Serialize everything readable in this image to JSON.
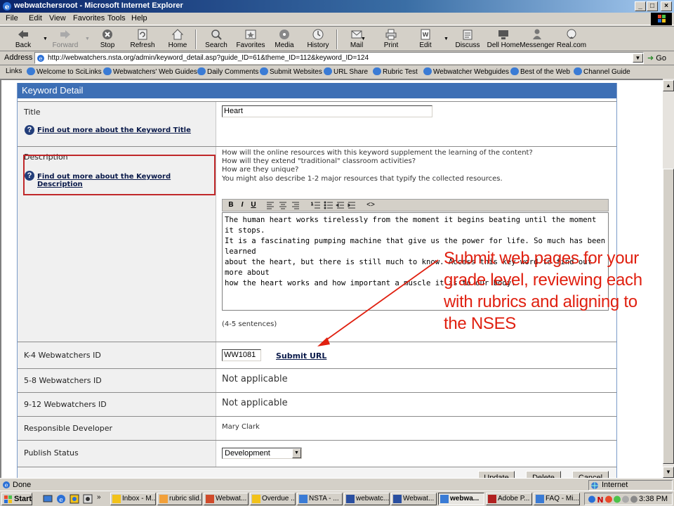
{
  "window": {
    "title": "webwatchersroot - Microsoft Internet Explorer",
    "minimize": "_",
    "maximize": "□",
    "close": "×"
  },
  "menu": [
    "File",
    "Edit",
    "View",
    "Favorites",
    "Tools",
    "Help"
  ],
  "toolbar": {
    "buttons": [
      {
        "label": "Back",
        "icon": "back-arrow-icon"
      },
      {
        "label": "Forward",
        "icon": "forward-arrow-icon",
        "disabled": true
      },
      {
        "label": "Stop",
        "icon": "stop-icon"
      },
      {
        "label": "Refresh",
        "icon": "refresh-icon"
      },
      {
        "label": "Home",
        "icon": "home-icon"
      },
      {
        "label": "Search",
        "icon": "search-icon"
      },
      {
        "label": "Favorites",
        "icon": "favorites-icon"
      },
      {
        "label": "Media",
        "icon": "media-icon"
      },
      {
        "label": "History",
        "icon": "history-icon"
      },
      {
        "label": "Mail",
        "icon": "mail-icon"
      },
      {
        "label": "Print",
        "icon": "print-icon"
      },
      {
        "label": "Edit",
        "icon": "edit-icon"
      },
      {
        "label": "Discuss",
        "icon": "discuss-icon"
      },
      {
        "label": "Dell Home",
        "icon": "dell-home-icon"
      },
      {
        "label": "Messenger",
        "icon": "messenger-icon"
      },
      {
        "label": "Real.com",
        "icon": "real-icon"
      }
    ]
  },
  "address": {
    "label": "Address",
    "url": "http://webwatchers.nsta.org/admin/keyword_detail.asp?guide_ID=61&theme_ID=112&keyword_ID=124",
    "go": "Go"
  },
  "links": {
    "label": "Links",
    "items": [
      "Welcome to SciLinks",
      "Webwatchers' Web Guides",
      "Daily Comments",
      "Submit Websites",
      "URL Share",
      "Rubric Test",
      "Webwatcher Webguides",
      "Best of the Web",
      "Channel Guide"
    ]
  },
  "page": {
    "header": "Keyword Detail",
    "title_label": "Title",
    "title_value": "Heart",
    "title_help": "Find out more about the Keyword Title",
    "description_label": "Description",
    "description_help": "Find out more about the Keyword Description",
    "description_prompts": [
      "How will the online resources with this keyword supplement the learning of the content?",
      "How will they extend \"traditional\" classroom activities?",
      "How are they unique?",
      "You might also describe 1-2 major resources that typify the collected resources."
    ],
    "editor_buttons": [
      "B",
      "I",
      "U"
    ],
    "editor_text": "The human heart works tirelessly from the moment it begins beating until the moment it stops.\nIt is a fascinating pumping machine that give us the power for life. So much has been learned\nabout the heart, but there is still much to know. Access this key word to find out more about\nhow the heart works and how important a muscle it is to our body.",
    "sentence_hint": "(4-5 sentences)",
    "k4_label": "K-4 Webwatchers ID",
    "k4_value": "WW1081",
    "submit_url": "Submit URL",
    "g58_label": "5-8 Webwatchers ID",
    "g58_value": "Not applicable",
    "g912_label": "9-12 Webwatchers ID",
    "g912_value": "Not applicable",
    "dev_label": "Responsible Developer",
    "dev_value": "Mary Clark",
    "publish_label": "Publish Status",
    "publish_value": "Development",
    "buttons": {
      "update": "Update",
      "delete": "Delete",
      "cancel": "Cancel"
    }
  },
  "callout": "Submit web pages for your grade level, reviewing each with rubrics and aligning to the NSES",
  "status": {
    "text": "Done",
    "zone": "Internet"
  },
  "taskbar": {
    "start": "Start",
    "tasks": [
      {
        "label": "Inbox - M..."
      },
      {
        "label": "rubric slid..."
      },
      {
        "label": "Webwat..."
      },
      {
        "label": "Overdue ..."
      },
      {
        "label": "NSTA - ..."
      },
      {
        "label": "webwatc..."
      },
      {
        "label": "Webwat..."
      },
      {
        "label": "webwa...",
        "active": true
      },
      {
        "label": "Adobe P..."
      },
      {
        "label": "FAQ - Mi..."
      }
    ],
    "clock": "3:38 PM"
  },
  "colors": {
    "accent": "#3d6fb5",
    "callout": "#e02010",
    "highlight_box": "#c0282a"
  }
}
